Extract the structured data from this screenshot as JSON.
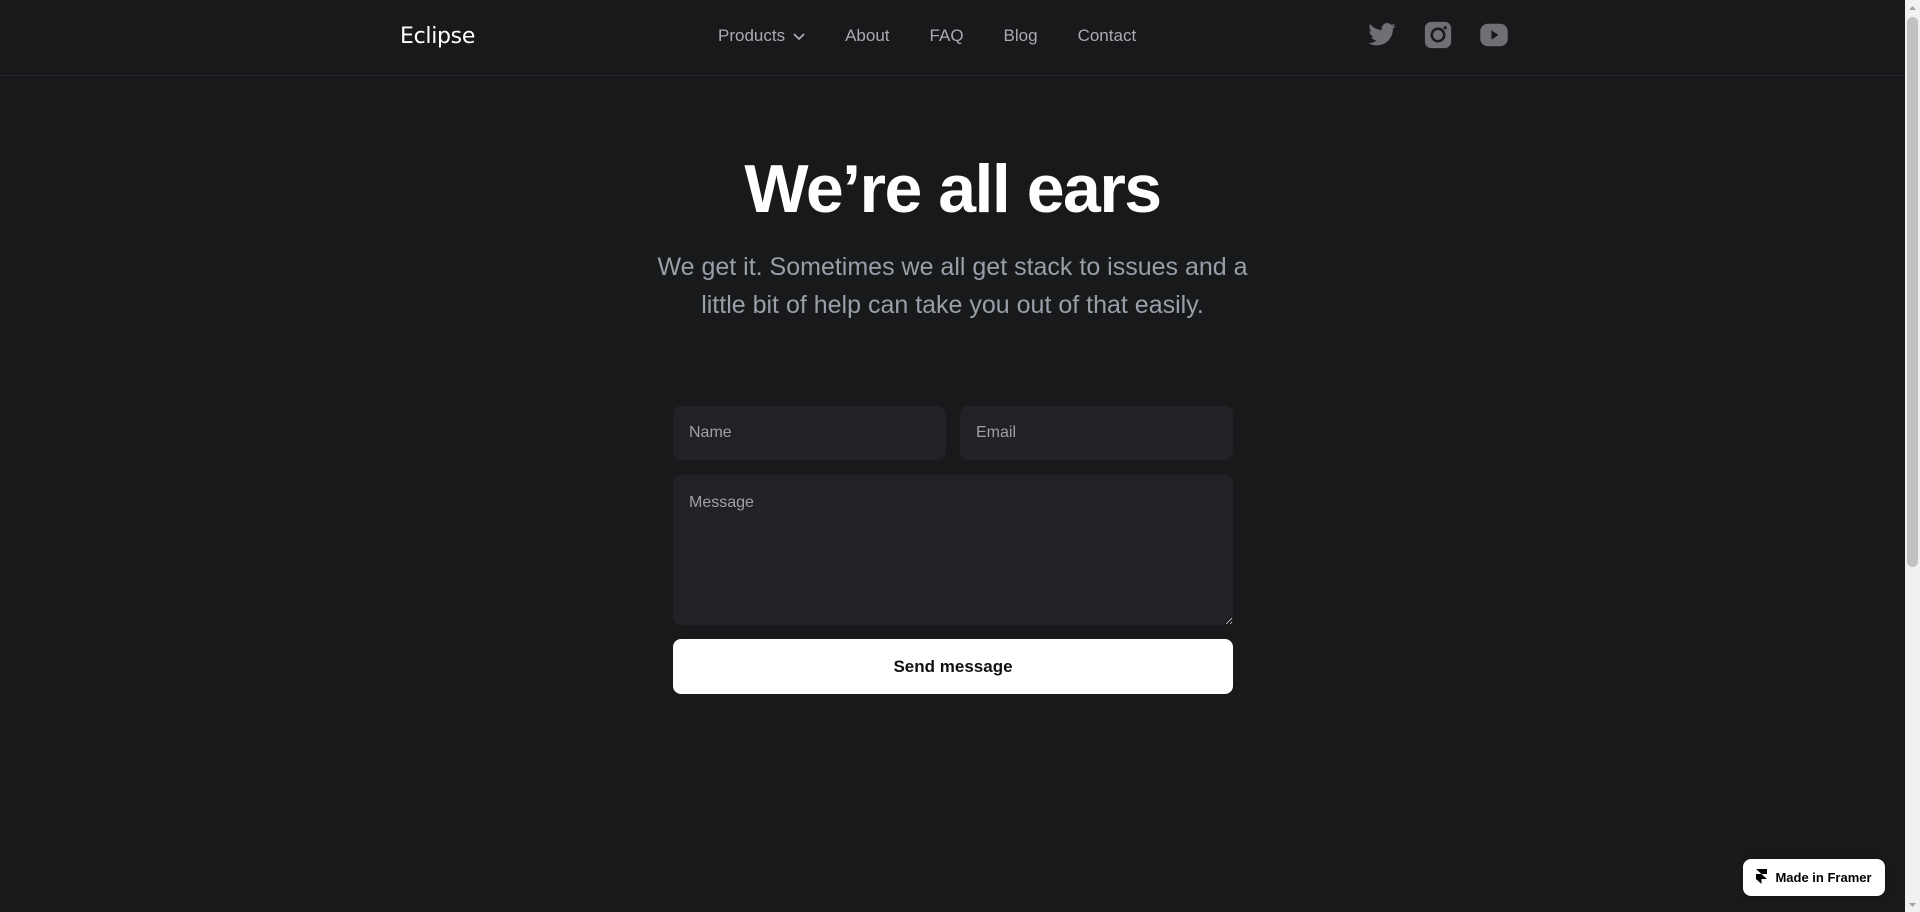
{
  "brand": {
    "name": "Eclipse"
  },
  "nav": {
    "items": [
      {
        "label": "Products",
        "has_dropdown": true
      },
      {
        "label": "About"
      },
      {
        "label": "FAQ"
      },
      {
        "label": "Blog"
      },
      {
        "label": "Contact"
      }
    ]
  },
  "social": {
    "icons": [
      "twitter-icon",
      "instagram-icon",
      "youtube-icon"
    ]
  },
  "hero": {
    "title": "We’re all ears",
    "subtitle": "We get it. Sometimes we all get stack to issues and a little bit of help can take you out of that easily."
  },
  "form": {
    "name_placeholder": "Name",
    "email_placeholder": "Email",
    "message_placeholder": "Message",
    "submit_label": "Send message"
  },
  "badge": {
    "label": "Made in Framer"
  },
  "colors": {
    "background": "#18191b",
    "field_background": "#212225",
    "nav_text": "#a9abb0",
    "subtitle_text": "#9a9ea8",
    "button_background": "#ffffff"
  }
}
